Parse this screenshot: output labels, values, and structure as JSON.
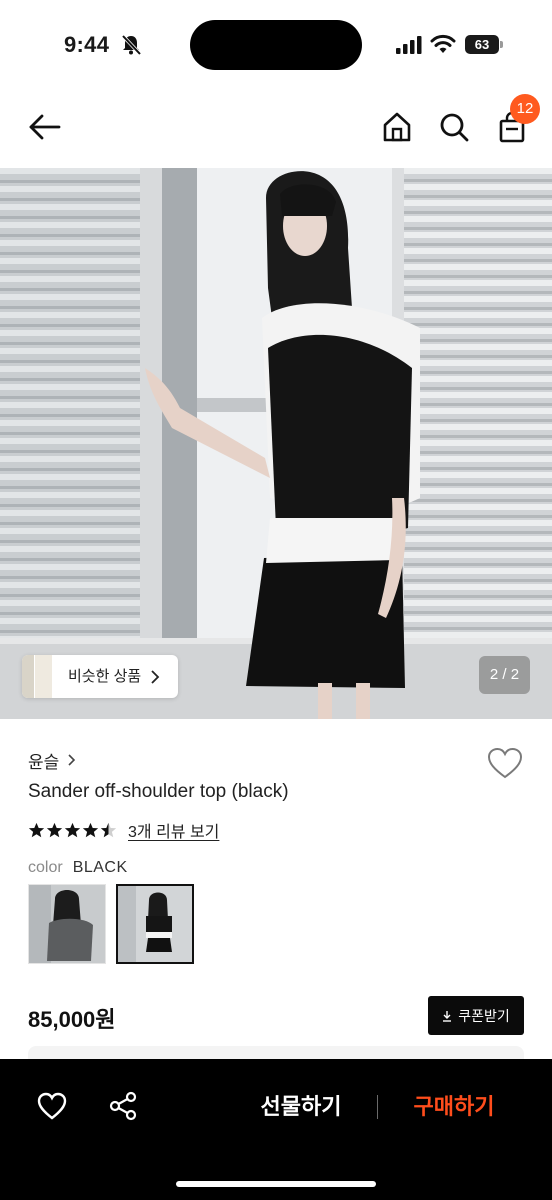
{
  "status_bar": {
    "time": "9:44",
    "battery": "63"
  },
  "nav": {
    "cart_count": "12",
    "icons": [
      "back-arrow-icon",
      "home-icon",
      "search-icon",
      "shopping-bag-icon"
    ]
  },
  "hero": {
    "similar_label": "비슷한 상품",
    "page_indicator": "2 / 2"
  },
  "product": {
    "brand": "윤슬",
    "title": "Sander off-shoulder top (black)",
    "rating": 4.5,
    "review_link": "3개 리뷰 보기",
    "color_label": "color",
    "color_value": "BLACK",
    "price": "85,000원",
    "coupon_label": "쿠폰받기"
  },
  "bottom_bar": {
    "gift_label": "선물하기",
    "buy_label": "구매하기"
  },
  "colors": {
    "accent": "#ff4d1c",
    "badge": "#ff5a1f",
    "dark": "#000000"
  }
}
